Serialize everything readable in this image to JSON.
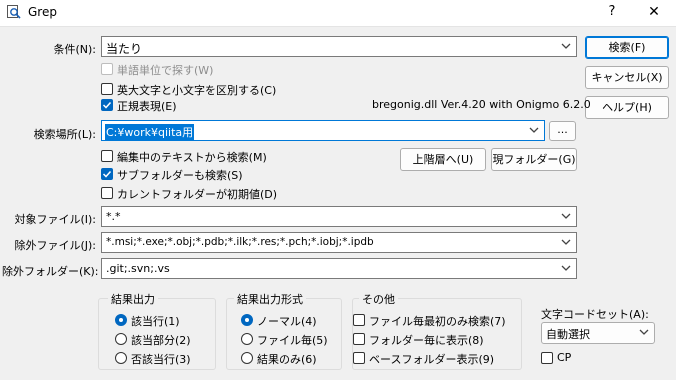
{
  "window": {
    "title": "Grep",
    "help_label": "?",
    "close_label": "✕",
    "icon": "grep-search-icon"
  },
  "condition": {
    "label": "条件(N):",
    "value": "当たり"
  },
  "options": {
    "word_unit": "単語単位で探す(W)",
    "case_sensitive": "英大文字と小文字を区別する(C)",
    "regex": "正規表現(E)",
    "regex_checked": true,
    "case_checked": false,
    "word_checked": false,
    "regex_engine": "bregonig.dll Ver.4.20 with Onigmo 6.2.0"
  },
  "location": {
    "label": "検索場所(L):",
    "value": "C:¥work¥qiita用",
    "browse_label": "..."
  },
  "location_options": {
    "from_editing": "編集中のテキストから検索(M)",
    "subfolders": "サブフォルダーも検索(S)",
    "current_folder_default": "カレントフォルダーが初期値(D)",
    "from_editing_checked": false,
    "subfolders_checked": true,
    "current_folder_checked": false
  },
  "folder_buttons": {
    "up": "上階層へ(U)",
    "current": "現フォルダー(G)"
  },
  "target_file": {
    "label": "対象ファイル(I):",
    "value": "*.*"
  },
  "exclude_file": {
    "label": "除外ファイル(J):",
    "value": "*.msi;*.exe;*.obj;*.pdb;*.ilk;*.res;*.pch;*.iobj;*.ipdb"
  },
  "exclude_folder": {
    "label": "除外フォルダー(K):",
    "value": ".git;.svn;.vs"
  },
  "buttons": {
    "search": "検索(F)",
    "cancel": "キャンセル(X)",
    "help": "ヘルプ(H)"
  },
  "result_output": {
    "title": "結果出力",
    "options": [
      "該当行(1)",
      "該当部分(2)",
      "否該当行(3)"
    ],
    "selected": 0
  },
  "result_format": {
    "title": "結果出力形式",
    "options": [
      "ノーマル(4)",
      "ファイル毎(5)",
      "結果のみ(6)"
    ],
    "selected": 0
  },
  "other": {
    "title": "その他",
    "options": [
      "ファイル毎最初のみ検索(7)",
      "フォルダー毎に表示(8)",
      "ベースフォルダー表示(9)"
    ]
  },
  "charset": {
    "label": "文字コードセット(A):",
    "value": "自動選択",
    "cp_label": "CP"
  },
  "colors": {
    "accent": "#0067c0",
    "selection": "#0078d7"
  }
}
